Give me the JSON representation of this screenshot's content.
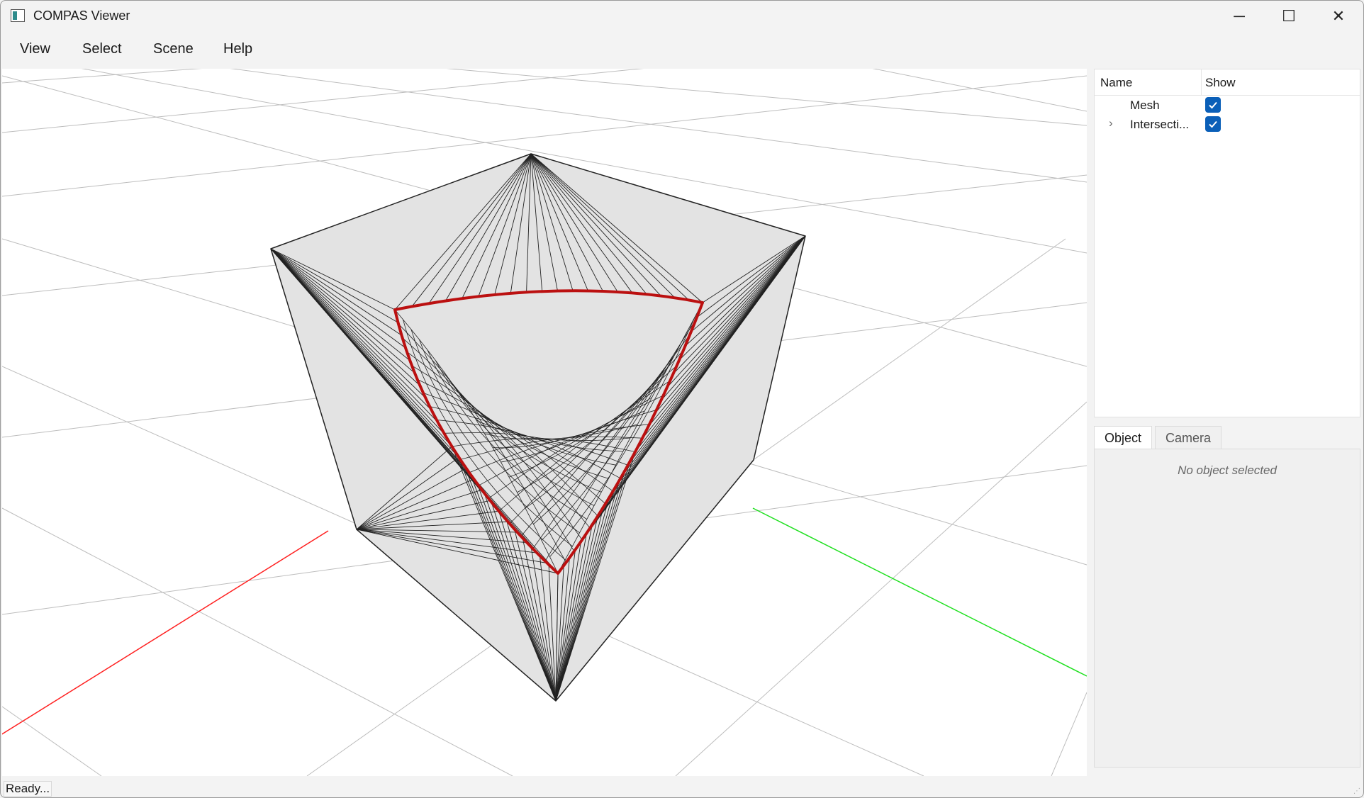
{
  "window": {
    "title": "COMPAS Viewer",
    "icon": "app-icon",
    "controls": {
      "minimize": "─",
      "maximize": "☐",
      "close": "✕"
    }
  },
  "menu": {
    "items": [
      {
        "label": "View"
      },
      {
        "label": "Select"
      },
      {
        "label": "Scene"
      },
      {
        "label": "Help"
      }
    ]
  },
  "scene_tree": {
    "columns": {
      "name": "Name",
      "show": "Show"
    },
    "rows": [
      {
        "label": "Mesh",
        "visible": true,
        "expandable": false
      },
      {
        "label": "Intersecti...",
        "visible": true,
        "expandable": true
      }
    ]
  },
  "inspector": {
    "tabs": [
      {
        "label": "Object",
        "active": true
      },
      {
        "label": "Camera",
        "active": false
      }
    ],
    "empty_message": "No object selected"
  },
  "status": {
    "text": "Ready..."
  },
  "viewport": {
    "colors": {
      "grid": "#bdbdbd",
      "x_axis": "#ff2020",
      "y_axis": "#20e020",
      "mesh_face": "#e3e3e3",
      "mesh_edge": "#222222",
      "intersection": "#bb1010"
    }
  }
}
